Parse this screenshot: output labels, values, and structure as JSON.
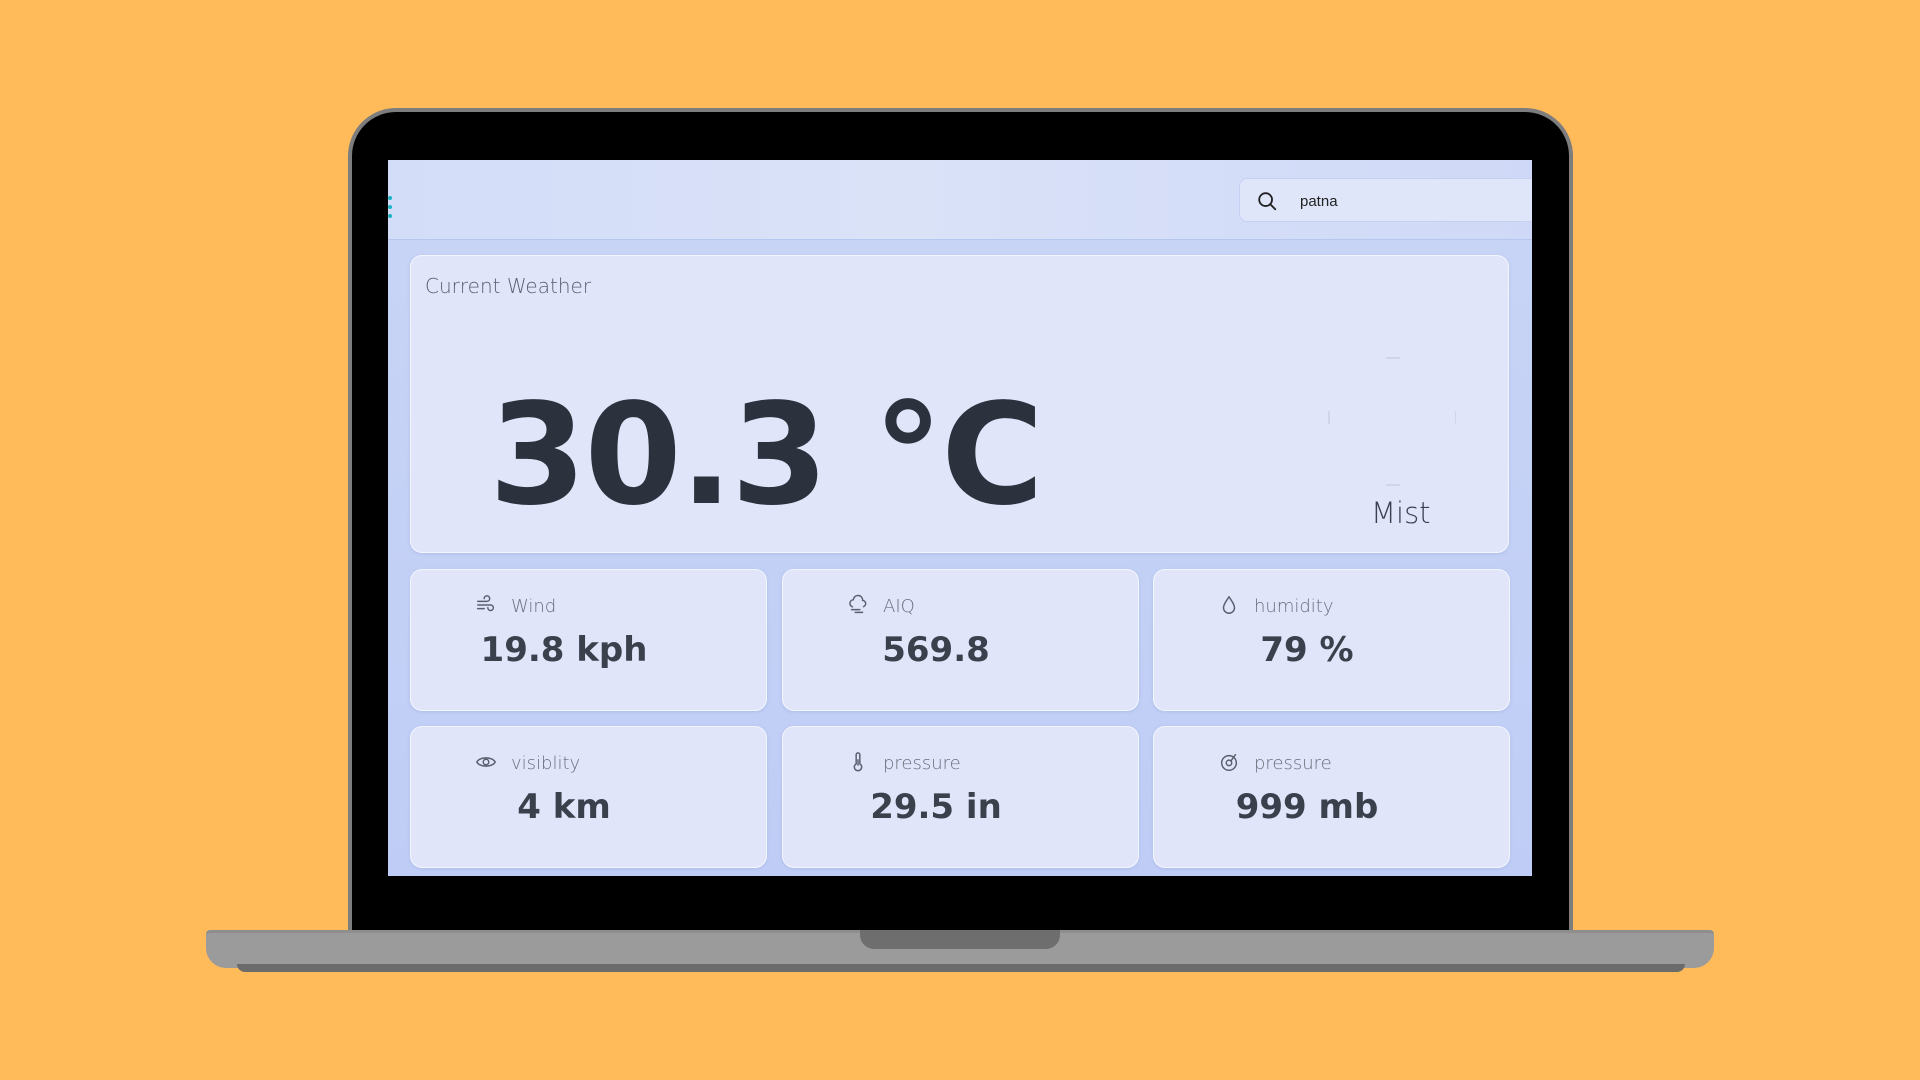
{
  "search": {
    "value": "patna",
    "icon": "search-icon"
  },
  "current": {
    "title": "Current Weather",
    "temperature": "30.3 °C",
    "condition": "Mist",
    "condition_icon": "mist-icon"
  },
  "stats": [
    {
      "label": "Wind",
      "value": "19.8 kph",
      "icon": "wind-icon"
    },
    {
      "label": "AIQ",
      "value": "569.8",
      "icon": "cloud-icon"
    },
    {
      "label": "humidity",
      "value": "79 %",
      "icon": "droplet-icon"
    },
    {
      "label": "visiblity",
      "value": "4 km",
      "icon": "eye-icon"
    },
    {
      "label": "pressure",
      "value": "29.5 in",
      "icon": "thermometer-icon"
    },
    {
      "label": "pressure",
      "value": "999 mb",
      "icon": "gauge-icon"
    }
  ],
  "colors": {
    "background": "#ffbb5a",
    "screen": "#c9d5f5",
    "card": "#e0e5fa",
    "text_dark": "#2b323d",
    "accent": "#19b3c6"
  }
}
